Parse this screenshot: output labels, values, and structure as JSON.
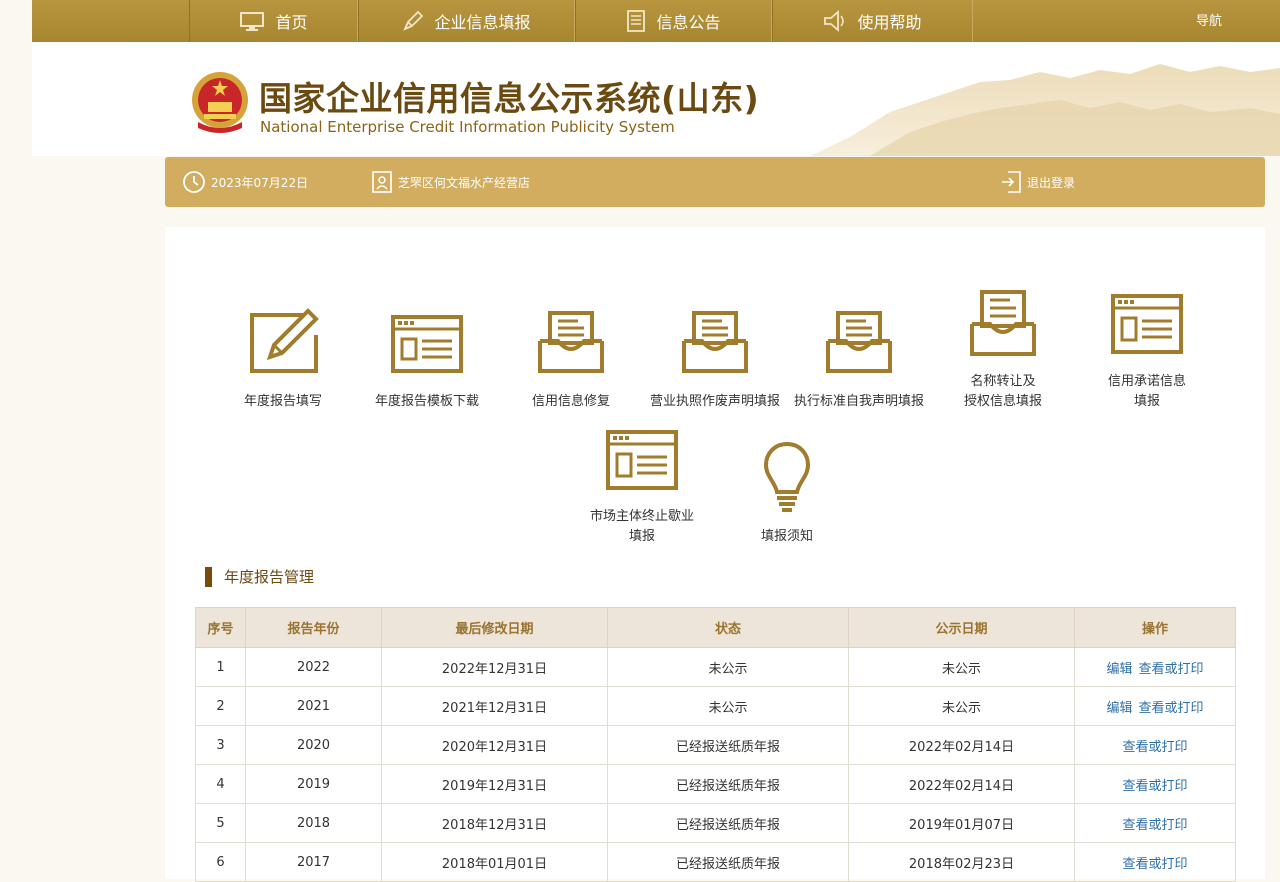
{
  "nav": {
    "items": [
      {
        "label": "首页",
        "icon": "monitor-icon"
      },
      {
        "label": "企业信息填报",
        "icon": "pen-icon"
      },
      {
        "label": "信息公告",
        "icon": "document-icon"
      },
      {
        "label": "使用帮助",
        "icon": "speaker-icon"
      }
    ],
    "guide": "导航"
  },
  "header": {
    "title": "国家企业信用信息公示系统(山东)",
    "subtitle": "National Enterprise Credit Information Publicity System"
  },
  "infobar": {
    "date": "2023年07月22日",
    "company": "芝罘区何文福水产经营店",
    "logout": "退出登录"
  },
  "tiles": [
    {
      "label": "年度报告填写",
      "icon": "edit-icon"
    },
    {
      "label": "年度报告模板下载",
      "icon": "template-icon"
    },
    {
      "label": "信用信息修复",
      "icon": "inbox-icon"
    },
    {
      "label": "营业执照作废声明填报",
      "icon": "inbox-icon"
    },
    {
      "label": "执行标准自我声明填报",
      "icon": "inbox-icon"
    },
    {
      "label": "名称转让及\n授权信息填报",
      "icon": "inbox-icon"
    },
    {
      "label": "信用承诺信息\n填报",
      "icon": "template-icon"
    },
    {
      "label": "市场主体终止歇业\n填报",
      "icon": "template-icon"
    },
    {
      "label": "填报须知",
      "icon": "lightbulb-icon"
    }
  ],
  "section": {
    "title": "年度报告管理"
  },
  "table": {
    "headers": [
      "序号",
      "报告年份",
      "最后修改日期",
      "状态",
      "公示日期",
      "操作"
    ],
    "rows": [
      {
        "no": "1",
        "year": "2022",
        "modified": "2022年12月31日",
        "status": "未公示",
        "pub": "未公示",
        "actions": [
          "编辑",
          "查看或打印"
        ]
      },
      {
        "no": "2",
        "year": "2021",
        "modified": "2021年12月31日",
        "status": "未公示",
        "pub": "未公示",
        "actions": [
          "编辑",
          "查看或打印"
        ]
      },
      {
        "no": "3",
        "year": "2020",
        "modified": "2020年12月31日",
        "status": "已经报送纸质年报",
        "pub": "2022年02月14日",
        "actions": [
          "查看或打印"
        ]
      },
      {
        "no": "4",
        "year": "2019",
        "modified": "2019年12月31日",
        "status": "已经报送纸质年报",
        "pub": "2022年02月14日",
        "actions": [
          "查看或打印"
        ]
      },
      {
        "no": "5",
        "year": "2018",
        "modified": "2018年12月31日",
        "status": "已经报送纸质年报",
        "pub": "2019年01月07日",
        "actions": [
          "查看或打印"
        ]
      },
      {
        "no": "6",
        "year": "2017",
        "modified": "2018年01月01日",
        "status": "已经报送纸质年报",
        "pub": "2018年02月23日",
        "actions": [
          "查看或打印"
        ]
      }
    ]
  },
  "colors": {
    "gold": "#b18f3b",
    "bar": "#d2ad5f",
    "icon": "#a07c2c",
    "link": "#2f6fa8"
  }
}
